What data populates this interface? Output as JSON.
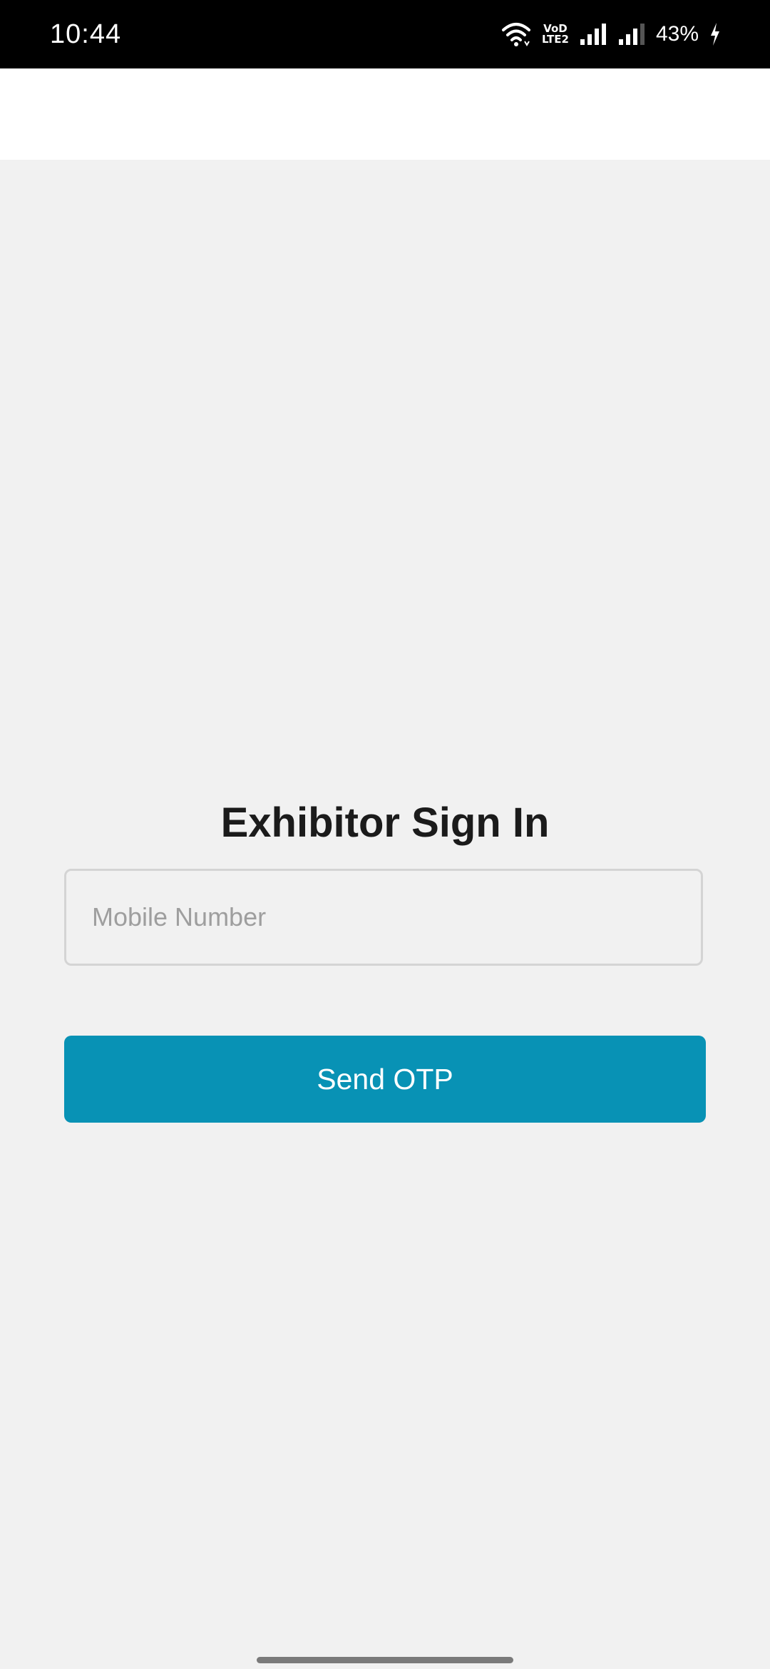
{
  "status_bar": {
    "time": "10:44",
    "volte_label_top": "VoD",
    "volte_label_bottom": "LTE2",
    "battery_percent": "43%",
    "icons": [
      "wifi-icon",
      "volte-icon",
      "signal-icon",
      "signal-icon",
      "battery-charging-icon"
    ]
  },
  "login": {
    "title": "Exhibitor Sign In",
    "mobile_placeholder": "Mobile Number",
    "mobile_value": "",
    "send_button_label": "Send OTP"
  },
  "colors": {
    "primary_button": "#0892b5",
    "background": "#f1f1f1",
    "app_bar": "#ffffff",
    "status_bar": "#000000"
  }
}
